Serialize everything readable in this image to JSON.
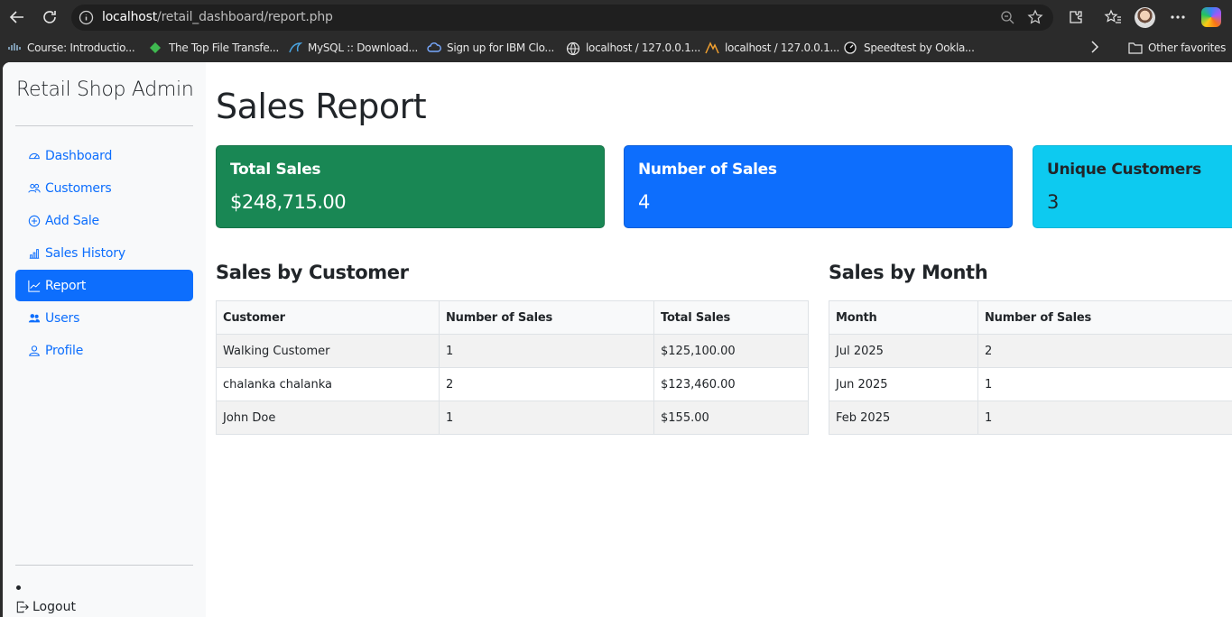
{
  "browser": {
    "url_host": "localhost",
    "url_path": "/retail_dashboard/report.php",
    "bookmarks": [
      {
        "label": "Course: Introductio...",
        "icon": "cisco-icon"
      },
      {
        "label": "The Top File Transfe...",
        "icon": "diamond-icon"
      },
      {
        "label": "MySQL :: Download...",
        "icon": "mysql-dolphin-icon"
      },
      {
        "label": "Sign up for IBM Clo...",
        "icon": "ibm-cloud-icon"
      },
      {
        "label": "localhost / 127.0.0.1...",
        "icon": "globe-icon"
      },
      {
        "label": "localhost / 127.0.0.1...",
        "icon": "phpmyadmin-icon"
      },
      {
        "label": "Speedtest by Ookla...",
        "icon": "speedtest-icon"
      }
    ],
    "other_favorites": "Other favorites"
  },
  "sidebar": {
    "brand": "Retail Shop Admin",
    "items": [
      {
        "label": "Dashboard",
        "icon": "speedometer-icon",
        "active": false
      },
      {
        "label": "Customers",
        "icon": "people-icon",
        "active": false
      },
      {
        "label": "Add Sale",
        "icon": "plus-circle-icon",
        "active": false
      },
      {
        "label": "Sales History",
        "icon": "bar-chart-icon",
        "active": false
      },
      {
        "label": "Report",
        "icon": "graph-up-icon",
        "active": true
      },
      {
        "label": "Users",
        "icon": "people-fill-icon",
        "active": false
      },
      {
        "label": "Profile",
        "icon": "person-icon",
        "active": false
      }
    ],
    "logout": "Logout"
  },
  "main": {
    "title": "Sales Report",
    "cards": [
      {
        "title": "Total Sales",
        "value": "$248,715.00",
        "color": "#198754"
      },
      {
        "title": "Number of Sales",
        "value": "4",
        "color": "#0d6efd"
      },
      {
        "title": "Unique Customers",
        "value": "3",
        "color": "#0dcaf0"
      }
    ],
    "by_customer": {
      "title": "Sales by Customer",
      "columns": [
        "Customer",
        "Number of Sales",
        "Total Sales"
      ],
      "rows": [
        [
          "Walking Customer",
          "1",
          "$125,100.00"
        ],
        [
          "chalanka chalanka",
          "2",
          "$123,460.00"
        ],
        [
          "John Doe",
          "1",
          "$155.00"
        ]
      ]
    },
    "by_month": {
      "title": "Sales by Month",
      "columns": [
        "Month",
        "Number of Sales"
      ],
      "rows": [
        [
          "Jul 2025",
          "2"
        ],
        [
          "Jun 2025",
          "1"
        ],
        [
          "Feb 2025",
          "1"
        ]
      ]
    }
  }
}
